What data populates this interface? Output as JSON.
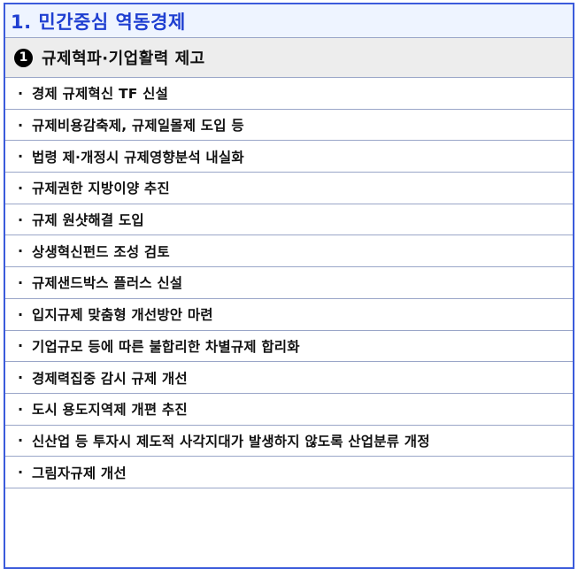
{
  "section": {
    "title": "1. 민간중심 역동경제"
  },
  "subsection": {
    "number": "1",
    "title": "규제혁파·기업활력 제고"
  },
  "bullet": "·",
  "items": [
    "경제 규제혁신 TF 신설",
    "규제비용감축제, 규제일몰제 도입 등",
    "법령 제·개정시 규제영향분석 내실화",
    "규제권한 지방이양 추진",
    "규제 원샷해결 도입",
    "상생혁신펀드 조성 검토",
    "규제샌드박스 플러스 신설",
    "입지규제 맞춤형 개선방안 마련",
    "기업규모 등에 따른 불합리한 차별규제 합리화",
    "경제력집중 감시 규제 개선",
    "도시 용도지역제 개편 추진",
    "신산업 등 투자시 제도적 사각지대가 발생하지 않도록 산업분류 개정",
    "그림자규제 개선"
  ]
}
